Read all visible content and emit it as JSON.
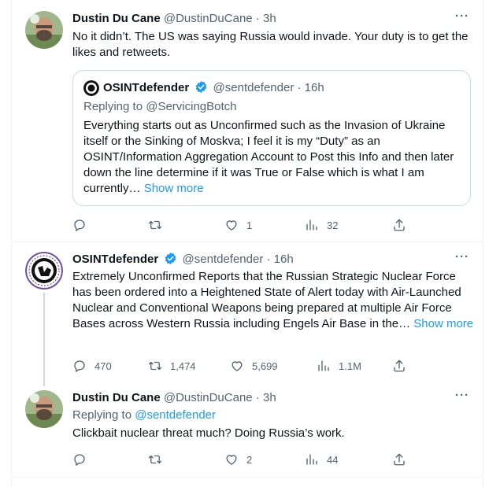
{
  "tweet1": {
    "name": "Dustin Du Cane",
    "handle": "@DustinDuCane",
    "time": "· 3h",
    "text": "No it didn’t. The US was saying Russia would invade. Your duty is to get the likes and retweets.",
    "quote": {
      "name": "OSINTdefender",
      "handle": "@sentdefender",
      "time": "· 16h",
      "replying_prefix": "Replying to",
      "replying_handle": "@ServicingBotch",
      "text": "Everything starts out as Unconfirmed such as the Invasion of Ukraine itself or the Sinking of Moskva; I feel it is my “Duty” as an OSINT/Information Aggregation Account to Post this Info and then later down the line determine if it was True or False which is what I am currently…",
      "show_more": "Show more"
    },
    "actions": {
      "replies": "",
      "retweets": "",
      "likes": "1",
      "views": "32"
    }
  },
  "tweet2": {
    "name": "OSINTdefender",
    "handle": "@sentdefender",
    "time": "· 16h",
    "text": "Extremely Unconfirmed Reports that the Russian Strategic Nuclear Force has been ordered into a Heightened State of Alert today with Air-Launched Nuclear and Conventional Weapons being prepared at multiple Air Force Bases across Western Russia including Engels Air Base in the…",
    "show_more": "Show more",
    "actions": {
      "replies": "470",
      "retweets": "1,474",
      "likes": "5,699",
      "views": "1.1M"
    }
  },
  "tweet3": {
    "name": "Dustin Du Cane",
    "handle": "@DustinDuCane",
    "time": "· 3h",
    "replying_prefix": "Replying to",
    "replying_handle": "@sentdefender",
    "text": "Clickbait nuclear threat much? Doing Russia’s work.",
    "actions": {
      "replies": "",
      "retweets": "",
      "likes": "2",
      "views": "44"
    }
  },
  "more_label": "···",
  "icons": {
    "reply": "reply-icon",
    "retweet": "retweet-icon",
    "like": "heart-icon",
    "views": "views-icon",
    "share": "share-icon",
    "verified": "verified-badge-icon"
  },
  "colors": {
    "accent": "#1d9bf0",
    "muted": "#536471",
    "border": "#cfd9de"
  }
}
